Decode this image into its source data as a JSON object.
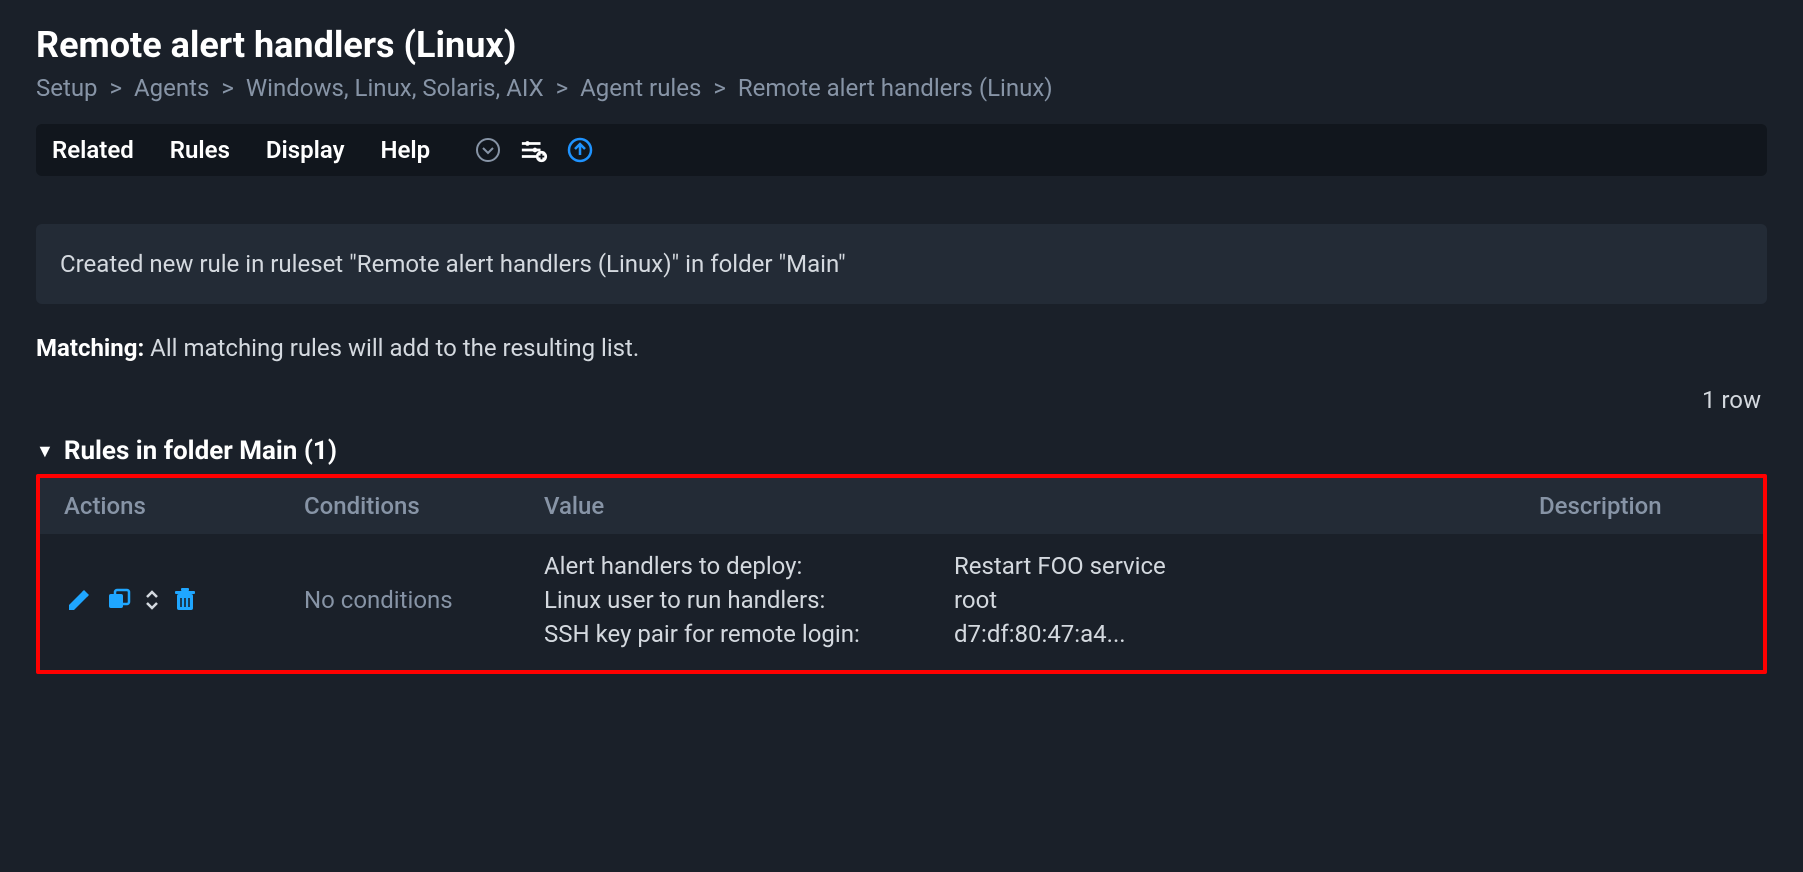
{
  "header": {
    "title": "Remote alert handlers (Linux)",
    "breadcrumbs": [
      "Setup",
      "Agents",
      "Windows, Linux, Solaris, AIX",
      "Agent rules",
      "Remote alert handlers (Linux)"
    ]
  },
  "toolbar": {
    "menu": [
      "Related",
      "Rules",
      "Display",
      "Help"
    ]
  },
  "notice": "Created new rule in ruleset \"Remote alert handlers (Linux)\" in folder \"Main\"",
  "matching": {
    "label": "Matching:",
    "text": "All matching rules will add to the resulting list."
  },
  "row_count": "1 row",
  "section": {
    "title": "Rules in folder Main (1)"
  },
  "table": {
    "headers": {
      "actions": "Actions",
      "conditions": "Conditions",
      "value": "Value",
      "description": "Description"
    },
    "rows": [
      {
        "conditions": "No conditions",
        "value": [
          {
            "k": "Alert handlers to deploy:",
            "v": "Restart FOO service"
          },
          {
            "k": "Linux user to run handlers:",
            "v": "root"
          },
          {
            "k": "SSH key pair for remote login:",
            "v": "d7:df:80:47:a4..."
          }
        ],
        "description": ""
      }
    ]
  }
}
